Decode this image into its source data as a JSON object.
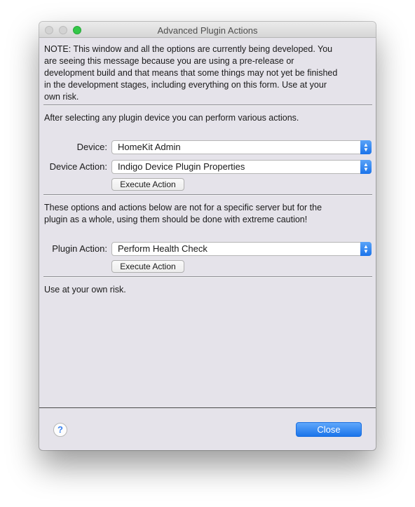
{
  "window": {
    "title": "Advanced Plugin Actions"
  },
  "note": {
    "line1": "NOTE: This window and all the options are currently being developed.  You",
    "line2": "are seeing this message because you are using a pre-release or",
    "line3": "development build and that means that some things may not yet be finished",
    "line4": "in the development stages, including everything on this form.  Use at your",
    "line5": "own risk."
  },
  "device_section": {
    "intro": "After selecting any plugin device you can perform various actions.",
    "device_label": "Device:",
    "device_value": "HomeKit Admin",
    "action_label": "Device Action:",
    "action_value": "Indigo Device Plugin Properties",
    "execute_label": "Execute Action"
  },
  "plugin_section": {
    "intro_line1": "These options and actions below are not for a specific server but for the",
    "intro_line2": "plugin as a whole, using them should be done with extreme caution!",
    "action_label": "Plugin Action:",
    "action_value": "Perform Health Check",
    "execute_label": "Execute Action"
  },
  "footer_note": "Use at your own risk.",
  "buttons": {
    "help": "?",
    "close": "Close"
  },
  "colors": {
    "accent": "#1a74ea",
    "window_bg": "#e5e3ea",
    "zoom_light": "#33c748"
  },
  "icons": {
    "help": "question-mark-icon",
    "stepper": "up-down-chevron-icon"
  }
}
